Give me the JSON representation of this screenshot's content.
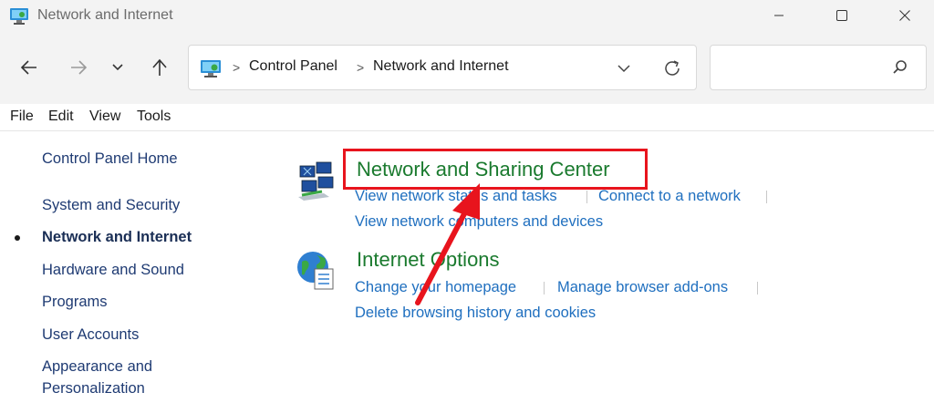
{
  "window": {
    "title": "Network and Internet",
    "buttons": {
      "minimize": "minimize",
      "maximize": "maximize",
      "close": "close"
    }
  },
  "address": {
    "crumbs": [
      "Control Panel",
      "Network and Internet"
    ],
    "separator": ">"
  },
  "search": {
    "placeholder": ""
  },
  "menu": [
    "File",
    "Edit",
    "View",
    "Tools"
  ],
  "sidebar": {
    "items": [
      {
        "label": "Control Panel Home"
      },
      {
        "label": "System and Security"
      },
      {
        "label": "Network and Internet",
        "current": true
      },
      {
        "label": "Hardware and Sound"
      },
      {
        "label": "Programs"
      },
      {
        "label": "User Accounts"
      },
      {
        "label": "Appearance and"
      },
      {
        "label": "Personalization"
      }
    ]
  },
  "categories": [
    {
      "title": "Network and Sharing Center",
      "icon": "network-sharing-icon",
      "links": [
        "View network status and tasks",
        "Connect to a network",
        "View network computers and devices"
      ]
    },
    {
      "title": "Internet Options",
      "icon": "internet-options-icon",
      "links": [
        "Change your homepage",
        "Manage browser add-ons",
        "Delete browsing history and cookies"
      ]
    }
  ],
  "colors": {
    "category_title": "#1a7a2e",
    "link": "#1f6fbf",
    "highlight": "#e8141d"
  }
}
